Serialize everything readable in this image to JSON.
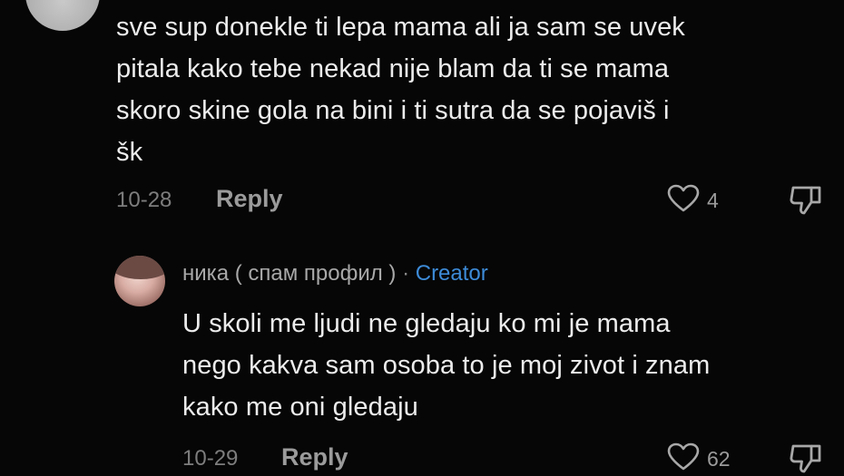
{
  "comment1": {
    "lines": [
      "sve sup donekle ti lepa mama ali ja sam se uvek",
      "pitala kako tebe nekad nije blam da ti se mama",
      "skoro skine gola na bini i ti sutra da se pojaviš i",
      "šk"
    ],
    "date": "10-28",
    "reply_label": "Reply",
    "likes": "4"
  },
  "comment2": {
    "username": "ника ( спам профил )",
    "separator": "·",
    "creator_badge": "Creator",
    "lines": [
      "U skoli me ljudi ne gledaju ko mi je mama",
      "nego kakva sam osoba to je moj zivot i znam",
      "kako me oni gledaju"
    ],
    "date": "10-29",
    "reply_label": "Reply",
    "likes": "62"
  },
  "icons": {
    "like": "heart-outline-icon",
    "dislike": "thumbs-down-icon"
  },
  "colors": {
    "background": "#060606",
    "text": "#ececec",
    "secondary": "#9b9b9b",
    "creator": "#3d8bd8"
  }
}
